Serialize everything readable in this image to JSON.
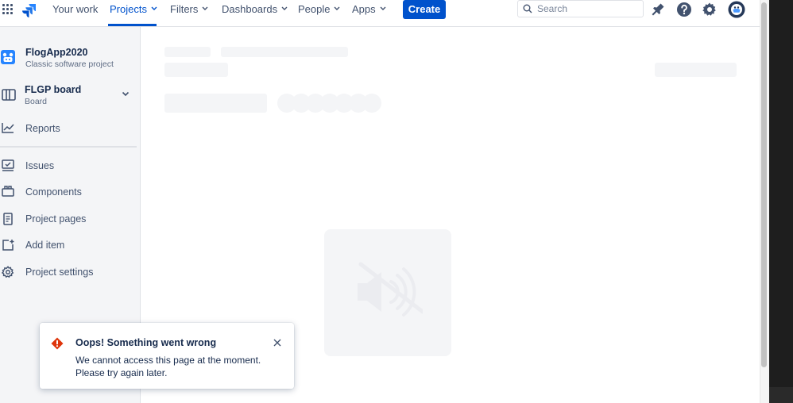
{
  "topbar": {
    "nav": [
      {
        "label": "Your work",
        "dropdown": false
      },
      {
        "label": "Projects",
        "dropdown": true,
        "active": true
      },
      {
        "label": "Filters",
        "dropdown": true
      },
      {
        "label": "Dashboards",
        "dropdown": true
      },
      {
        "label": "People",
        "dropdown": true
      },
      {
        "label": "Apps",
        "dropdown": true
      }
    ],
    "create_label": "Create",
    "search_placeholder": "Search",
    "icons": [
      "notifications-icon",
      "help-icon",
      "settings-icon",
      "profile-avatar"
    ]
  },
  "sidebar": {
    "project": {
      "name": "FlogApp2020",
      "type": "Classic software project"
    },
    "board": {
      "name": "FLGP board",
      "subtitle": "Board"
    },
    "items": [
      {
        "label": "Reports",
        "icon": "reports-icon"
      },
      {
        "label": "Issues",
        "icon": "issues-icon"
      },
      {
        "label": "Components",
        "icon": "components-icon"
      },
      {
        "label": "Project pages",
        "icon": "project-pages-icon"
      },
      {
        "label": "Add item",
        "icon": "add-item-icon"
      },
      {
        "label": "Project settings",
        "icon": "gear-icon"
      }
    ]
  },
  "flag": {
    "title": "Oops! Something went wrong",
    "body": "We cannot access this page at the moment. Please try again later.",
    "icon": "error-icon"
  },
  "colors": {
    "brand": "#0052CC",
    "text": "#172B4D",
    "subtle_text": "#42526E",
    "sidebar_bg": "#F4F5F7",
    "error": "#DE350B"
  }
}
